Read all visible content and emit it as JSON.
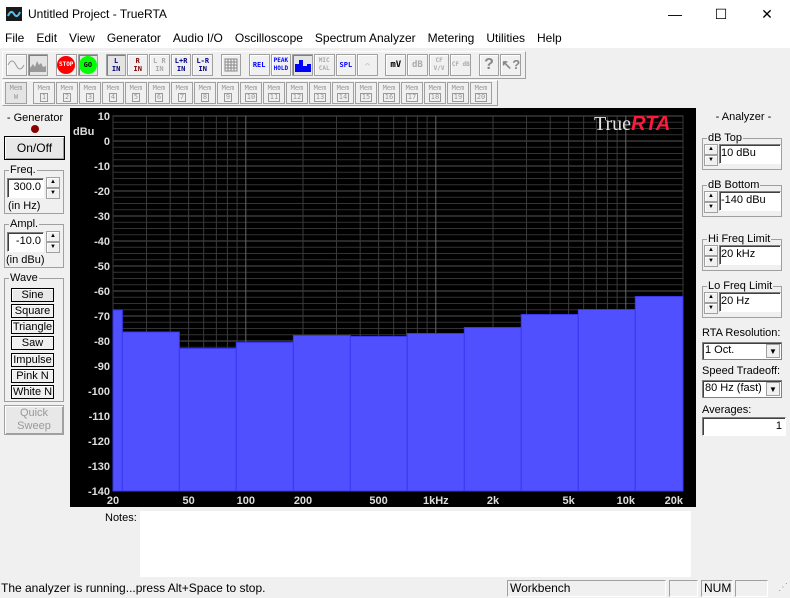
{
  "window": {
    "title": "Untitled Project - TrueRTA",
    "minimize": "—",
    "maximize": "☐",
    "close": "✕"
  },
  "menu": [
    "File",
    "Edit",
    "View",
    "Generator",
    "Audio I/O",
    "Oscilloscope",
    "Spectrum Analyzer",
    "Metering",
    "Utilities",
    "Help"
  ],
  "toolbar": {
    "stop": "STOP",
    "go": "GO",
    "l_in": "L\nIN",
    "r_in": "R\nIN",
    "lr_in": "L R\nIN",
    "lpr_in": "L+R\nIN",
    "lmr_in": "L-R\nIN",
    "rel": "REL",
    "peak_hold": "PEAK HOLD",
    "mic_cal": "MIC CAL",
    "spl": "SPL",
    "mv": "mV",
    "db": "dB",
    "cf_vv": "CF V/V",
    "cf_db": "CF dB",
    "help": "?"
  },
  "memory": {
    "w_label": "Mem",
    "w_sub": "W",
    "label": "Mem",
    "slots": [
      "1",
      "2",
      "3",
      "4",
      "5",
      "6",
      "7",
      "8",
      "9",
      "10",
      "11",
      "12",
      "13",
      "14",
      "15",
      "16",
      "17",
      "18",
      "19",
      "20"
    ]
  },
  "generator": {
    "title": "- Generator -",
    "onoff": "On/Off",
    "freq_label": "Freq.",
    "freq_value": "300.0",
    "freq_unit": "(in Hz)",
    "ampl_label": "Ampl.",
    "ampl_value": "-10.0",
    "ampl_unit": "(in dBu)",
    "wave_label": "Wave",
    "waves": [
      "Sine",
      "Square",
      "Triangle",
      "Saw",
      "Impulse",
      "Pink N",
      "White N"
    ],
    "selected_wave": "Sine",
    "quick_sweep": "Quick Sweep"
  },
  "analyzer": {
    "title": "- Analyzer -",
    "db_top_label": "dB Top",
    "db_top": "10 dBu",
    "db_bottom_label": "dB Bottom",
    "db_bottom": "-140 dBu",
    "hi_freq_label": "Hi Freq Limit",
    "hi_freq": "20 kHz",
    "lo_freq_label": "Lo Freq Limit",
    "lo_freq": "20 Hz",
    "resolution_label": "RTA Resolution:",
    "resolution": "1 Oct.",
    "speed_label": "Speed Tradeoff:",
    "speed": "80 Hz (fast)",
    "averages_label": "Averages:",
    "averages": "1"
  },
  "notes": {
    "label": "Notes:",
    "value": ""
  },
  "status": {
    "message": "The analyzer is running...press Alt+Space to stop.",
    "mode": "Workbench",
    "num": "NUM"
  },
  "brand": {
    "true": "True",
    "rta": "RTA",
    "rta_color": "#ff1a3c"
  },
  "chart_data": {
    "type": "bar",
    "title": "",
    "ylabel": "dBu",
    "xlabel": "",
    "ylim": [
      -140,
      10
    ],
    "xlim_hz": [
      20,
      20000
    ],
    "x_scale": "log",
    "yticks": [
      10,
      0,
      -10,
      -20,
      -30,
      -40,
      -50,
      -60,
      -70,
      -80,
      -90,
      -100,
      -110,
      -120,
      -130,
      -140
    ],
    "xticks": [
      {
        "hz": 20,
        "label": "20"
      },
      {
        "hz": 50,
        "label": "50"
      },
      {
        "hz": 100,
        "label": "100"
      },
      {
        "hz": 200,
        "label": "200"
      },
      {
        "hz": 500,
        "label": "500"
      },
      {
        "hz": 1000,
        "label": "1kHz"
      },
      {
        "hz": 2000,
        "label": "2k"
      },
      {
        "hz": 5000,
        "label": "5k"
      },
      {
        "hz": 10000,
        "label": "10k"
      },
      {
        "hz": 20000,
        "label": "20k"
      }
    ],
    "bar_color": "#5050ff",
    "bars": [
      {
        "lo": 20,
        "hi": 22.4,
        "value": -67.6
      },
      {
        "lo": 22.4,
        "hi": 44.7,
        "value": -76.4
      },
      {
        "lo": 44.7,
        "hi": 89.1,
        "value": -83
      },
      {
        "lo": 89.1,
        "hi": 178,
        "value": -80.6
      },
      {
        "lo": 178,
        "hi": 355,
        "value": -77.8
      },
      {
        "lo": 355,
        "hi": 708,
        "value": -78.2
      },
      {
        "lo": 708,
        "hi": 1413,
        "value": -77
      },
      {
        "lo": 1413,
        "hi": 2818,
        "value": -74.6
      },
      {
        "lo": 2818,
        "hi": 5623,
        "value": -69.4
      },
      {
        "lo": 5623,
        "hi": 11220,
        "value": -67.4
      },
      {
        "lo": 11220,
        "hi": 20000,
        "value": -62.2
      }
    ],
    "grid": true
  }
}
